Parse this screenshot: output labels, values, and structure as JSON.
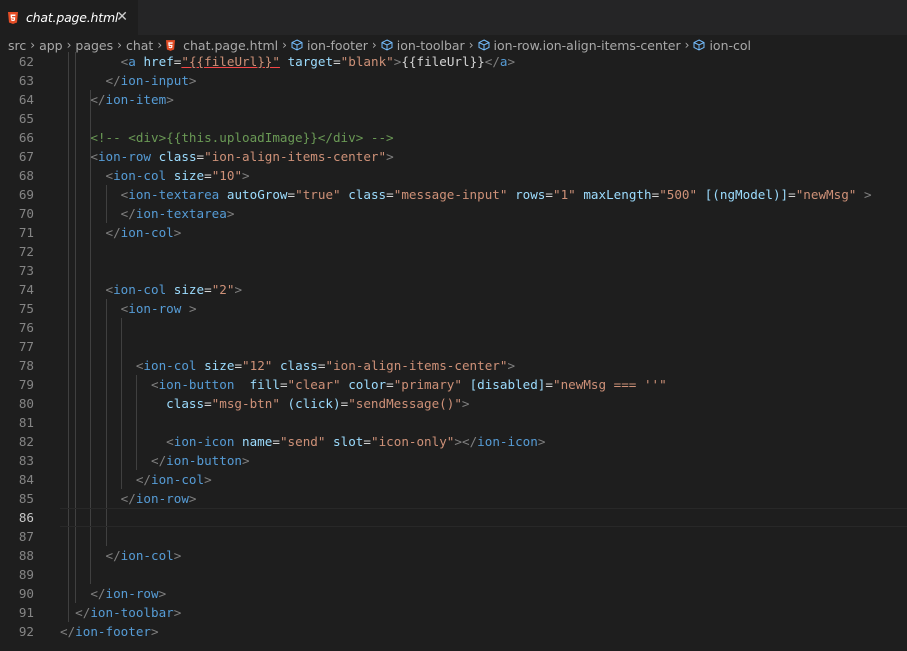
{
  "tab": {
    "label": "chat.page.html",
    "close_glyph": "✕"
  },
  "breadcrumb": [
    "src",
    "app",
    "pages",
    "chat",
    "chat.page.html",
    "ion-footer",
    "ion-toolbar",
    "ion-row.ion-align-items-center",
    "ion-col"
  ],
  "colors": {
    "tag": "#569cd6",
    "attribute": "#9cdcfe",
    "string": "#ce9178",
    "comment": "#6a9955",
    "bracket": "#808080"
  },
  "editor": {
    "active_line": 86,
    "lines": [
      {
        "n": "62",
        "indent": "        ",
        "tokens": [
          [
            "p",
            "<"
          ],
          [
            "t",
            "a"
          ],
          [
            "x",
            " "
          ],
          [
            "a",
            "href"
          ],
          [
            "x",
            "="
          ],
          [
            "s",
            "\"{{fileUrl}}\""
          ],
          [
            "x",
            " "
          ],
          [
            "a",
            "target"
          ],
          [
            "x",
            "="
          ],
          [
            "s",
            "\"blank\""
          ],
          [
            "p",
            ">"
          ],
          [
            "x",
            "{{fileUrl}}"
          ],
          [
            "p",
            "</"
          ],
          [
            "t",
            "a"
          ],
          [
            "p",
            ">"
          ]
        ]
      },
      {
        "n": "63",
        "indent": "      ",
        "tokens": [
          [
            "p",
            "</"
          ],
          [
            "t",
            "ion-input"
          ],
          [
            "p",
            ">"
          ]
        ]
      },
      {
        "n": "64",
        "indent": "    ",
        "tokens": [
          [
            "p",
            "</"
          ],
          [
            "t",
            "ion-item"
          ],
          [
            "p",
            ">"
          ]
        ]
      },
      {
        "n": "65",
        "indent": "",
        "tokens": []
      },
      {
        "n": "66",
        "indent": "    ",
        "tokens": [
          [
            "c",
            "<!-- <div>{{this.uploadImage}}</div> -->"
          ]
        ]
      },
      {
        "n": "67",
        "indent": "    ",
        "tokens": [
          [
            "p",
            "<"
          ],
          [
            "t",
            "ion-row"
          ],
          [
            "x",
            " "
          ],
          [
            "a",
            "class"
          ],
          [
            "x",
            "="
          ],
          [
            "s",
            "\"ion-align-items-center\""
          ],
          [
            "p",
            ">"
          ]
        ]
      },
      {
        "n": "68",
        "indent": "      ",
        "tokens": [
          [
            "p",
            "<"
          ],
          [
            "t",
            "ion-col"
          ],
          [
            "x",
            " "
          ],
          [
            "a",
            "size"
          ],
          [
            "x",
            "="
          ],
          [
            "s",
            "\"10\""
          ],
          [
            "p",
            ">"
          ]
        ]
      },
      {
        "n": "69",
        "indent": "        ",
        "tokens": [
          [
            "p",
            "<"
          ],
          [
            "t",
            "ion-textarea"
          ],
          [
            "x",
            " "
          ],
          [
            "a",
            "autoGrow"
          ],
          [
            "x",
            "="
          ],
          [
            "s",
            "\"true\""
          ],
          [
            "x",
            " "
          ],
          [
            "a",
            "class"
          ],
          [
            "x",
            "="
          ],
          [
            "s",
            "\"message-input\""
          ],
          [
            "x",
            " "
          ],
          [
            "a",
            "rows"
          ],
          [
            "x",
            "="
          ],
          [
            "s",
            "\"1\""
          ],
          [
            "x",
            " "
          ],
          [
            "a",
            "maxLength"
          ],
          [
            "x",
            "="
          ],
          [
            "s",
            "\"500\""
          ],
          [
            "x",
            " "
          ],
          [
            "a",
            "[(ngModel)]"
          ],
          [
            "x",
            "="
          ],
          [
            "s",
            "\"newMsg\""
          ],
          [
            "x",
            " "
          ],
          [
            "p",
            ">"
          ]
        ]
      },
      {
        "n": "70",
        "indent": "        ",
        "tokens": [
          [
            "p",
            "</"
          ],
          [
            "t",
            "ion-textarea"
          ],
          [
            "p",
            ">"
          ]
        ]
      },
      {
        "n": "71",
        "indent": "      ",
        "tokens": [
          [
            "p",
            "</"
          ],
          [
            "t",
            "ion-col"
          ],
          [
            "p",
            ">"
          ]
        ]
      },
      {
        "n": "72",
        "indent": "",
        "tokens": []
      },
      {
        "n": "73",
        "indent": "",
        "tokens": []
      },
      {
        "n": "74",
        "indent": "      ",
        "tokens": [
          [
            "p",
            "<"
          ],
          [
            "t",
            "ion-col"
          ],
          [
            "x",
            " "
          ],
          [
            "a",
            "size"
          ],
          [
            "x",
            "="
          ],
          [
            "s",
            "\"2\""
          ],
          [
            "p",
            ">"
          ]
        ]
      },
      {
        "n": "75",
        "indent": "        ",
        "tokens": [
          [
            "p",
            "<"
          ],
          [
            "t",
            "ion-row"
          ],
          [
            "x",
            " "
          ],
          [
            "p",
            ">"
          ]
        ]
      },
      {
        "n": "76",
        "indent": "",
        "tokens": []
      },
      {
        "n": "77",
        "indent": "",
        "tokens": []
      },
      {
        "n": "78",
        "indent": "          ",
        "tokens": [
          [
            "p",
            "<"
          ],
          [
            "t",
            "ion-col"
          ],
          [
            "x",
            " "
          ],
          [
            "a",
            "size"
          ],
          [
            "x",
            "="
          ],
          [
            "s",
            "\"12\""
          ],
          [
            "x",
            " "
          ],
          [
            "a",
            "class"
          ],
          [
            "x",
            "="
          ],
          [
            "s",
            "\"ion-align-items-center\""
          ],
          [
            "p",
            ">"
          ]
        ]
      },
      {
        "n": "79",
        "indent": "            ",
        "tokens": [
          [
            "p",
            "<"
          ],
          [
            "t",
            "ion-button"
          ],
          [
            "x",
            "  "
          ],
          [
            "a",
            "fill"
          ],
          [
            "x",
            "="
          ],
          [
            "s",
            "\"clear\""
          ],
          [
            "x",
            " "
          ],
          [
            "a",
            "color"
          ],
          [
            "x",
            "="
          ],
          [
            "s",
            "\"primary\""
          ],
          [
            "x",
            " "
          ],
          [
            "a",
            "[disabled]"
          ],
          [
            "x",
            "="
          ],
          [
            "s",
            "\"newMsg === ''\""
          ]
        ]
      },
      {
        "n": "80",
        "indent": "              ",
        "tokens": [
          [
            "a",
            "class"
          ],
          [
            "x",
            "="
          ],
          [
            "s",
            "\"msg-btn\""
          ],
          [
            "x",
            " "
          ],
          [
            "a",
            "(click)"
          ],
          [
            "x",
            "="
          ],
          [
            "s",
            "\"sendMessage()\""
          ],
          [
            "p",
            ">"
          ]
        ]
      },
      {
        "n": "81",
        "indent": "",
        "tokens": []
      },
      {
        "n": "82",
        "indent": "              ",
        "tokens": [
          [
            "p",
            "<"
          ],
          [
            "t",
            "ion-icon"
          ],
          [
            "x",
            " "
          ],
          [
            "a",
            "name"
          ],
          [
            "x",
            "="
          ],
          [
            "s",
            "\"send\""
          ],
          [
            "x",
            " "
          ],
          [
            "a",
            "slot"
          ],
          [
            "x",
            "="
          ],
          [
            "s",
            "\"icon-only\""
          ],
          [
            "p",
            ">"
          ],
          [
            "p",
            "</"
          ],
          [
            "t",
            "ion-icon"
          ],
          [
            "p",
            ">"
          ]
        ]
      },
      {
        "n": "83",
        "indent": "            ",
        "tokens": [
          [
            "p",
            "</"
          ],
          [
            "t",
            "ion-button"
          ],
          [
            "p",
            ">"
          ]
        ]
      },
      {
        "n": "84",
        "indent": "          ",
        "tokens": [
          [
            "p",
            "</"
          ],
          [
            "t",
            "ion-col"
          ],
          [
            "p",
            ">"
          ]
        ]
      },
      {
        "n": "85",
        "indent": "        ",
        "tokens": [
          [
            "p",
            "</"
          ],
          [
            "t",
            "ion-row"
          ],
          [
            "p",
            ">"
          ]
        ]
      },
      {
        "n": "86",
        "indent": "",
        "tokens": []
      },
      {
        "n": "87",
        "indent": "",
        "tokens": []
      },
      {
        "n": "88",
        "indent": "      ",
        "tokens": [
          [
            "p",
            "</"
          ],
          [
            "t",
            "ion-col"
          ],
          [
            "p",
            ">"
          ]
        ]
      },
      {
        "n": "89",
        "indent": "",
        "tokens": []
      },
      {
        "n": "90",
        "indent": "    ",
        "tokens": [
          [
            "p",
            "</"
          ],
          [
            "t",
            "ion-row"
          ],
          [
            "p",
            ">"
          ]
        ]
      },
      {
        "n": "91",
        "indent": "  ",
        "tokens": [
          [
            "p",
            "</"
          ],
          [
            "t",
            "ion-toolbar"
          ],
          [
            "p",
            ">"
          ]
        ]
      },
      {
        "n": "92",
        "indent": "",
        "tokens": [
          [
            "p",
            "</"
          ],
          [
            "t",
            "ion-footer"
          ],
          [
            "p",
            ">"
          ]
        ]
      }
    ]
  }
}
